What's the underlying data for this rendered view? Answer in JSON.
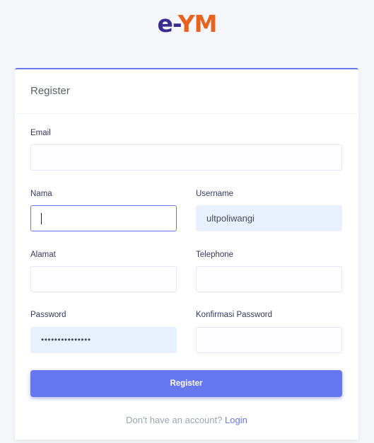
{
  "logo": {
    "part1": "e-",
    "part2": "YM"
  },
  "card": {
    "title": "Register"
  },
  "fields": {
    "email": {
      "label": "Email",
      "value": ""
    },
    "nama": {
      "label": "Nama",
      "value": ""
    },
    "username": {
      "label": "Username",
      "value": "ultpoliwangi"
    },
    "alamat": {
      "label": "Alamat",
      "value": ""
    },
    "telephone": {
      "label": "Telephone",
      "value": ""
    },
    "password": {
      "label": "Password",
      "value": "•••••••••••••••"
    },
    "konfirmasi": {
      "label": "Konfirmasi Password",
      "value": ""
    }
  },
  "register_button": "Register",
  "footer": {
    "prompt": "Don't have an account?",
    "link": "Login"
  },
  "colors": {
    "accent": "#6777ef",
    "autofill": "#e8f0fe",
    "logo_dark": "#3b2a8f",
    "logo_orange": "#e8621f"
  }
}
